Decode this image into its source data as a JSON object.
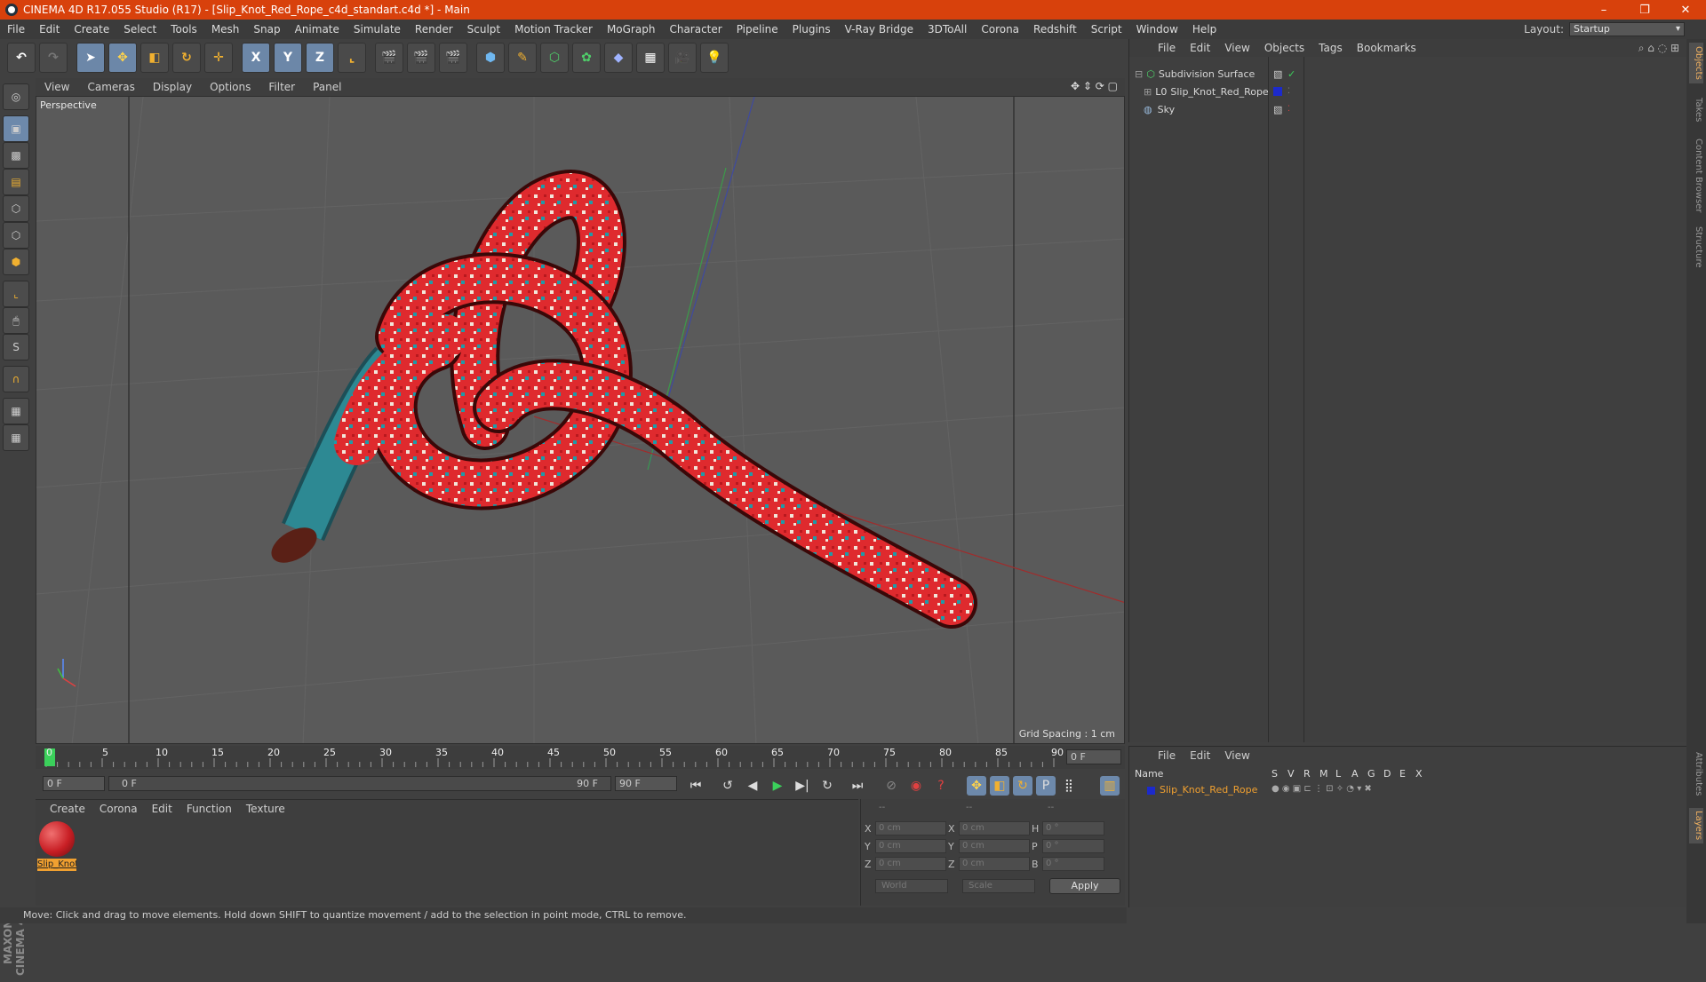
{
  "title": "CINEMA 4D R17.055 Studio (R17) - [Slip_Knot_Red_Rope_c4d_standart.c4d *] - Main",
  "window_buttons": [
    "–",
    "❐",
    "✕"
  ],
  "menu": [
    "File",
    "Edit",
    "Create",
    "Select",
    "Tools",
    "Mesh",
    "Snap",
    "Animate",
    "Simulate",
    "Render",
    "Sculpt",
    "Motion Tracker",
    "MoGraph",
    "Character",
    "Pipeline",
    "Plugins",
    "V-Ray Bridge",
    "3DToAll",
    "Corona",
    "Redshift",
    "Script",
    "Window",
    "Help"
  ],
  "layout": {
    "label": "Layout:",
    "value": "Startup"
  },
  "toolbar_axes": [
    "X",
    "Y",
    "Z"
  ],
  "viewport": {
    "menu": [
      "View",
      "Cameras",
      "Display",
      "Options",
      "Filter",
      "Panel"
    ],
    "label": "Perspective",
    "grid_spacing": "Grid Spacing : 1 cm"
  },
  "timeline": {
    "ticks": [
      "0",
      "5",
      "10",
      "15",
      "20",
      "25",
      "30",
      "35",
      "40",
      "45",
      "50",
      "55",
      "60",
      "65",
      "70",
      "75",
      "80",
      "85",
      "90"
    ],
    "current_frame": "0 F",
    "start": "0 F",
    "range_start": "0 F",
    "range_end": "90 F",
    "end": "90 F"
  },
  "material_panel": {
    "menu": [
      "Create",
      "Corona",
      "Edit",
      "Function",
      "Texture"
    ],
    "material_name": "Slip_Knot"
  },
  "coords": {
    "header": [
      "--",
      "--",
      "--"
    ],
    "rows": [
      {
        "a": "X",
        "av": "0 cm",
        "b": "X",
        "bv": "0 cm",
        "c": "H",
        "cv": "0 °"
      },
      {
        "a": "Y",
        "av": "0 cm",
        "b": "Y",
        "bv": "0 cm",
        "c": "P",
        "cv": "0 °"
      },
      {
        "a": "Z",
        "av": "0 cm",
        "b": "Z",
        "bv": "0 cm",
        "c": "B",
        "cv": "0 °"
      }
    ],
    "world": "World",
    "scale": "Scale",
    "apply": "Apply"
  },
  "object_manager": {
    "menu": [
      "File",
      "Edit",
      "View",
      "Objects",
      "Tags",
      "Bookmarks"
    ],
    "objects": [
      "Subdivision Surface",
      "Slip_Knot_Red_Rope",
      "Sky"
    ]
  },
  "layer_manager": {
    "menu": [
      "File",
      "Edit",
      "View"
    ],
    "columns": [
      "Name",
      "S",
      "V",
      "R",
      "M",
      "L",
      "A",
      "G",
      "D",
      "E",
      "X"
    ],
    "layer": "Slip_Knot_Red_Rope"
  },
  "right_tabs": [
    "Objects",
    "Takes",
    "Content Browser",
    "Structure",
    "Attributes",
    "Layers"
  ],
  "brand": "MAXON CINEMA 4D",
  "status": "Move: Click and drag to move elements. Hold down SHIFT to quantize movement / add to the selection in point mode, CTRL to remove.",
  "colors": {
    "title_bar": "#d8410c",
    "active_tool": "#6d89ab",
    "rope": "#e02a2a",
    "layer_name": "#f0a030"
  }
}
